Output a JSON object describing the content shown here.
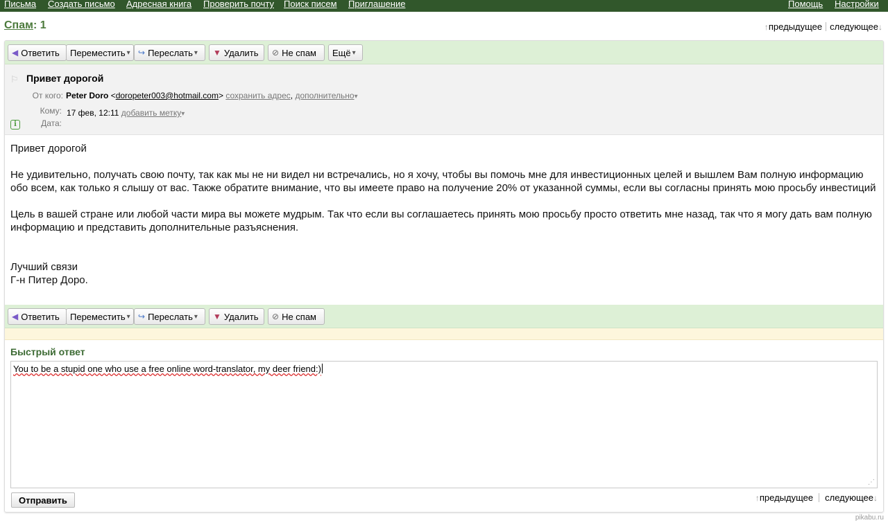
{
  "topnav": {
    "items": [
      "Письма",
      "Создать письмо",
      "Адресная книга",
      "Проверить почту",
      "Поиск писем",
      "Приглашение"
    ],
    "right": [
      "Помощь",
      "Настройки"
    ]
  },
  "folder": {
    "name": "Спам",
    "sep": ":",
    "count": "1"
  },
  "nav": {
    "prev": "предыдущее",
    "next": "следующее"
  },
  "toolbar": {
    "reply": "Ответить",
    "move": "Переместить",
    "forward": "Переслать",
    "delete": "Удалить",
    "notspam": "Не спам",
    "more": "Ещё"
  },
  "message": {
    "subject": "Привет дорогой",
    "from_label": "От кого:",
    "from_name": "Peter Doro",
    "from_email": "doropeter003@hotmail.com",
    "save_address": "сохранить адрес",
    "more_link": "дополнительно",
    "to_label": "Кому:",
    "date_value": "17 фев, 12:11",
    "add_label": "добавить метку",
    "date_label": "Дата:",
    "body": {
      "greeting": "Привет дорогой",
      "p1": "Не удивительно, получать свою почту, так как мы не ни видел ни встречались, но я хочу, чтобы вы помочь мне для инвестиционных целей и вышлем Вам полную информацию обо всем, как только я слышу от вас. Также обратите внимание, что вы имеете право на получение 20% от указанной суммы, если вы согласны принять мою просьбу инвестиций",
      "p2": "Цель в вашей стране или любой части мира вы можете мудрым. Так что если вы соглашаетесь принять мою просьбу просто ответить мне назад, так что я могу дать вам полную информацию и представить дополнительные разъяснения.",
      "sig1": "Лучший связи",
      "sig2": "Г-н Питер Доро."
    }
  },
  "quick_reply": {
    "title": "Быстрый ответ",
    "text": "You to be a stupid one who use a free online word-translator, my deer friend:)",
    "send": "Отправить"
  },
  "watermark": "pikabu.ru"
}
